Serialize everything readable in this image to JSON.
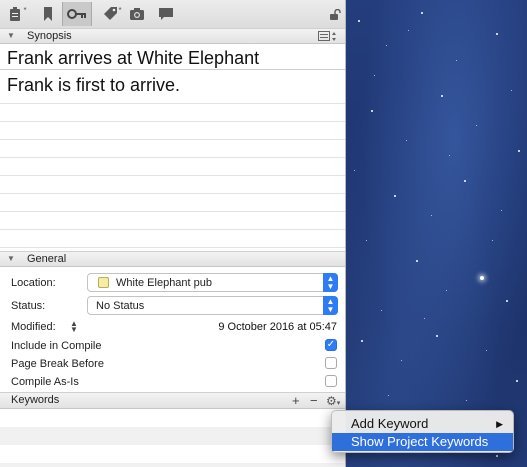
{
  "toolbar": {
    "icons": [
      "notes-icon",
      "bookmark-icon",
      "key-icon",
      "tag-icon",
      "camera-icon",
      "comment-icon",
      "lock-icon"
    ],
    "active": "key-icon"
  },
  "synopsis": {
    "header": "Synopsis",
    "title": "Frank arrives at White Elephant",
    "text": "Frank is first to arrive."
  },
  "general": {
    "header": "General",
    "location_label": "Location:",
    "location_value": "White Elephant pub",
    "status_label": "Status:",
    "status_value": "No Status",
    "modified_label": "Modified:",
    "modified_value": "9 October 2016 at 05:47",
    "include_label": "Include in Compile",
    "include_checked": true,
    "page_break_label": "Page Break Before",
    "page_break_checked": false,
    "compile_as_is_label": "Compile As-Is",
    "compile_as_is_checked": false
  },
  "keywords": {
    "header": "Keywords",
    "add": "+",
    "remove": "−"
  },
  "context_menu": {
    "items": [
      {
        "label": "Add Keyword",
        "submenu": true,
        "highlighted": false
      },
      {
        "label": "Show Project Keywords",
        "submenu": false,
        "highlighted": true
      }
    ]
  },
  "colors": {
    "accent": "#2f7df6",
    "highlight": "#2f6fdc",
    "location_swatch": "#f7eca2"
  }
}
